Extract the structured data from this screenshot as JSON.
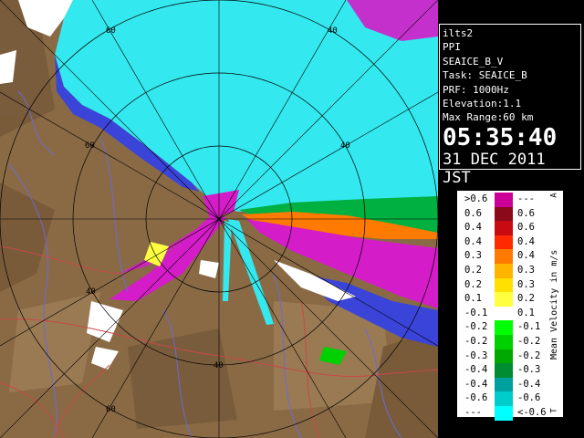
{
  "info": {
    "station": "ilts2",
    "mode": "PPI",
    "product": "SEAICE_B_V",
    "task": "Task: SEAICE_B",
    "prf": "PRF: 1000Hz",
    "elevation": "Elevation:1.1",
    "max_range": "Max Range:60 km",
    "time": "05:35:40",
    "date": "31 DEC 2011 JST"
  },
  "map": {
    "ring_labels": [
      "60",
      "40",
      "40",
      "60",
      "40",
      "40",
      "60"
    ],
    "colors": {
      "sea": "#33e8ee",
      "land": "#8a6a45",
      "echo_strong": "#d41cc8"
    }
  },
  "legend": {
    "title": "Mean Velocity in m/s",
    "corner_top": "A",
    "corner_bottom": "T",
    "rows": [
      {
        "left": ">0.6",
        "color": "#cc0099",
        "right": "---"
      },
      {
        "left": "0.6",
        "color": "#8a0a1a",
        "right": "0.6"
      },
      {
        "left": "0.4",
        "color": "#c80a12",
        "right": "0.6"
      },
      {
        "left": "0.4",
        "color": "#ff2a00",
        "right": "0.4"
      },
      {
        "left": "0.3",
        "color": "#ff7a00",
        "right": "0.4"
      },
      {
        "left": "0.2",
        "color": "#ffb400",
        "right": "0.3"
      },
      {
        "left": "0.2",
        "color": "#ffe000",
        "right": "0.3"
      },
      {
        "left": "0.1",
        "color": "#ffff40",
        "right": "0.2"
      },
      {
        "left": "-0.1",
        "color": "#ffffff",
        "right": "0.1"
      },
      {
        "left": "-0.2",
        "color": "#00ff00",
        "right": "-0.1"
      },
      {
        "left": "-0.2",
        "color": "#00d000",
        "right": "-0.2"
      },
      {
        "left": "-0.3",
        "color": "#00a800",
        "right": "-0.2"
      },
      {
        "left": "-0.4",
        "color": "#008c30",
        "right": "-0.3"
      },
      {
        "left": "-0.4",
        "color": "#00a0a0",
        "right": "-0.4"
      },
      {
        "left": "-0.6",
        "color": "#00cccc",
        "right": "-0.6"
      },
      {
        "left": "---",
        "color": "#00ffff",
        "right": "<-0.6"
      }
    ]
  }
}
